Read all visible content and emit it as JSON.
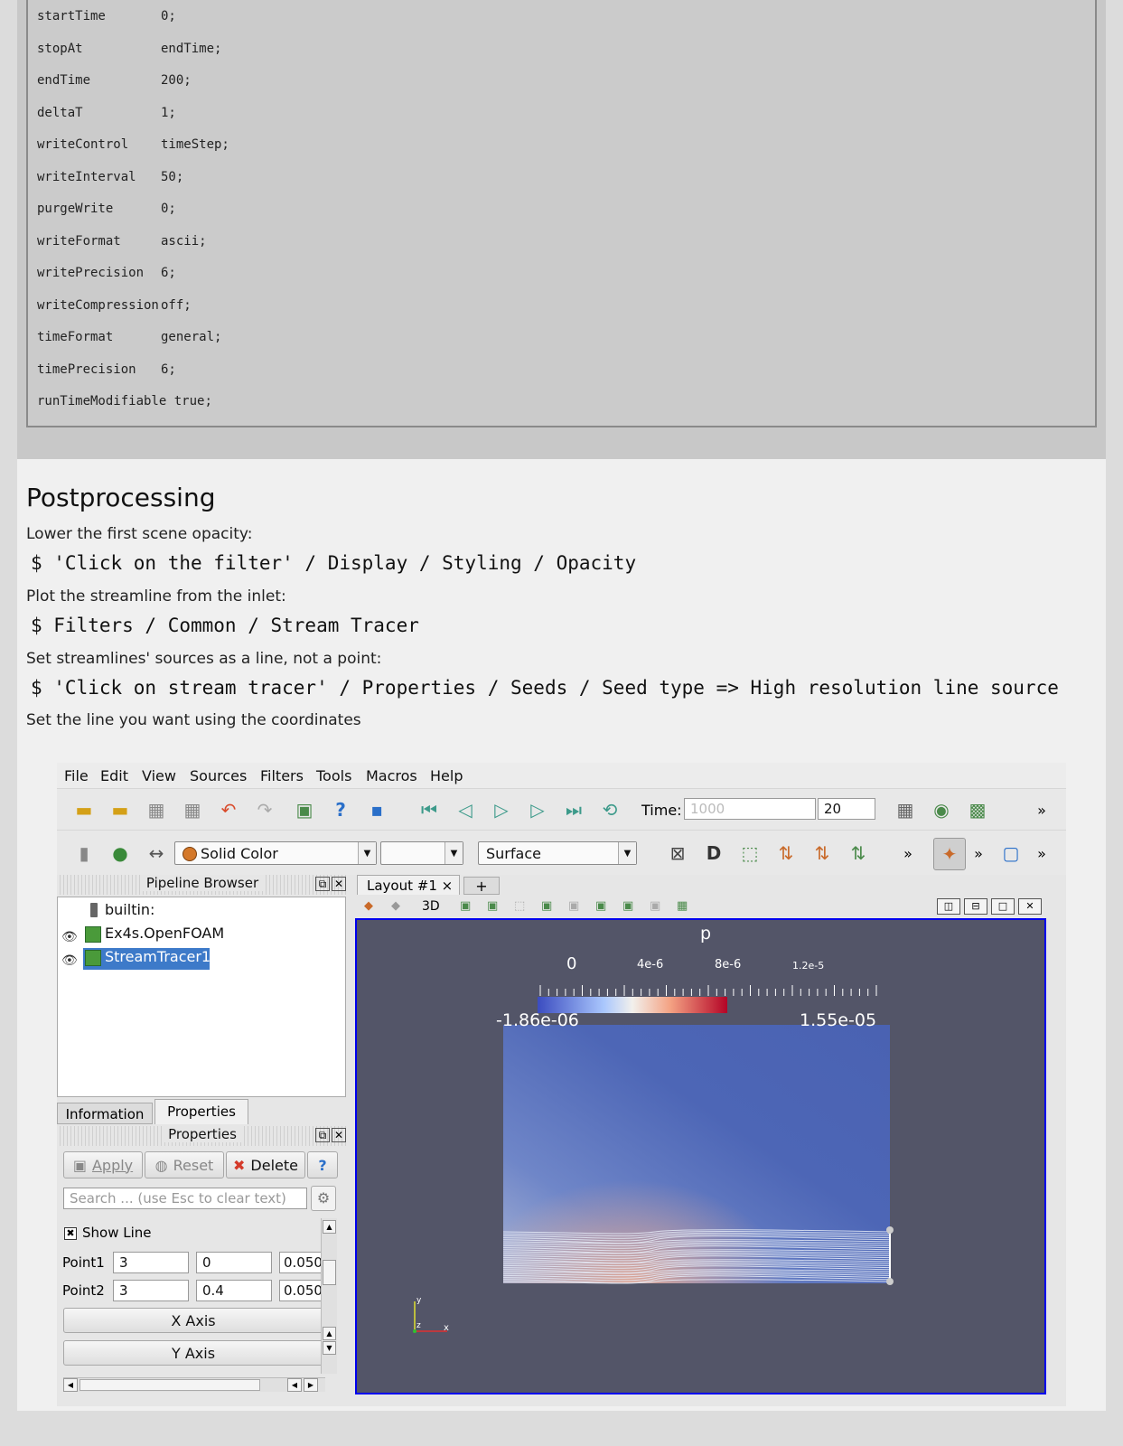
{
  "code_lines": [
    {
      "key": "startTime",
      "val": "0;"
    },
    {
      "key": "stopAt",
      "val": "endTime;"
    },
    {
      "key": "endTime",
      "val": "200;"
    },
    {
      "key": "deltaT",
      "val": "1;"
    },
    {
      "key": "writeControl",
      "val": "timeStep;"
    },
    {
      "key": "writeInterval",
      "val": "50;"
    },
    {
      "key": "purgeWrite",
      "val": "0;"
    },
    {
      "key": "writeFormat",
      "val": "ascii;"
    },
    {
      "key": "writePrecision",
      "val": "6;"
    },
    {
      "key": "writeCompression",
      "val": "off;"
    },
    {
      "key": "timeFormat",
      "val": "general;"
    },
    {
      "key": "timePrecision",
      "val": "6;"
    },
    {
      "key": "runTimeModifiable",
      "val": "true;"
    }
  ],
  "section": {
    "heading": "Postprocessing"
  },
  "steps": [
    {
      "text": "Lower the first scene opacity:",
      "command": "$ 'Click on the filter' / Display / Styling / Opacity"
    },
    {
      "text": "Plot the streamline from the inlet:",
      "command": "$ Filters / Common / Stream Tracer"
    },
    {
      "text": "Set streamlines' sources as a line, not a point:",
      "command": "$ 'Click on stream tracer' / Properties / Seeds / Seed type => High resolution line source"
    }
  ],
  "final_text": "Set the line you want using the coordinates",
  "app": {
    "menu": [
      "File",
      "Edit",
      "View",
      "Sources",
      "Filters",
      "Tools",
      "Macros",
      "Help"
    ],
    "time_label": "Time:",
    "time_value": "1000",
    "time_step": "20",
    "more": "»",
    "color_combo": "Solid Color",
    "repr_combo": "Surface",
    "pipeline_title": "Pipeline Browser",
    "pipeline_items": [
      "builtin:",
      "Ex4s.OpenFOAM",
      "StreamTracer1"
    ],
    "tabs": [
      "Information",
      "Properties"
    ],
    "properties_title": "Properties",
    "buttons": {
      "apply": "Apply",
      "reset": "Reset",
      "delete": "Delete",
      "help": "?"
    },
    "search_placeholder": "Search ... (use Esc to clear text)",
    "show_line": "Show Line",
    "point1": {
      "label": "Point1",
      "x": "3",
      "y": "0",
      "z": "0.050"
    },
    "point2": {
      "label": "Point2",
      "x": "3",
      "y": "0.4",
      "z": "0.050"
    },
    "x_axis": "X Axis",
    "y_axis": "Y Axis",
    "layout_tab": "Layout #1",
    "layout_close": "×",
    "add_tab": "+",
    "view_3d": "3D",
    "colorbar": {
      "title": "p",
      "ticks": [
        "0",
        "4e-6",
        "8e-6",
        "1.2e-5"
      ],
      "min": "-1.86e-06",
      "max": "1.55e-05"
    },
    "axes": {
      "x": "x",
      "y": "y",
      "z": "z"
    }
  },
  "colors": {
    "accent": "#0000ee",
    "selection": "#3d7ac9",
    "render_bg": "#535568"
  }
}
